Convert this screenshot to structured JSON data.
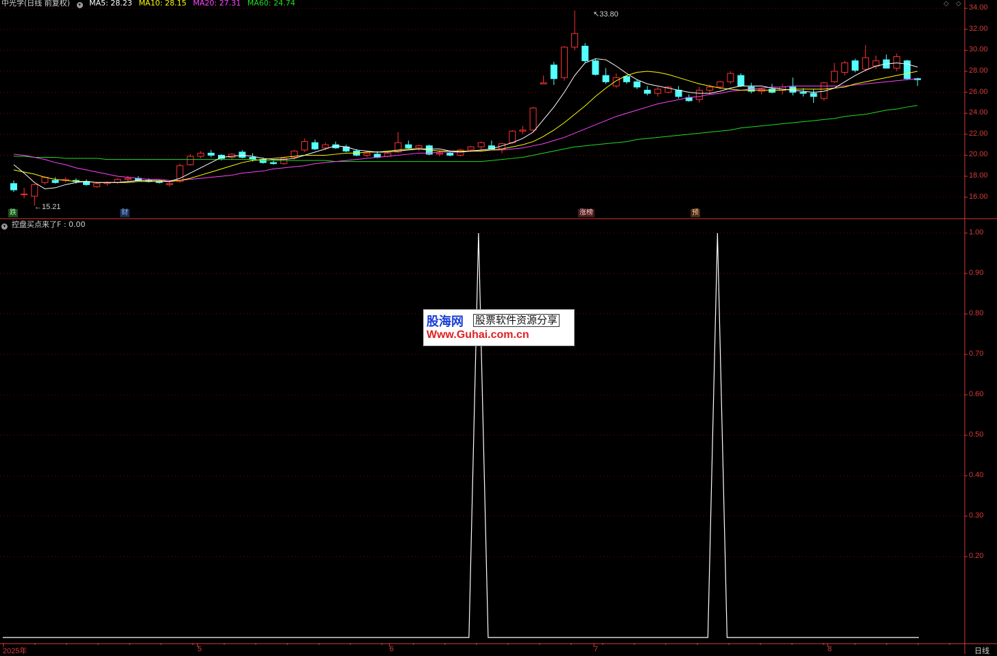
{
  "stock": {
    "title": "中光学(日线 前复权)"
  },
  "ma": {
    "ma5": "MA5: 28.23",
    "ma5_color": "#ffffff",
    "ma10": "MA10: 28.15",
    "ma10_color": "#ffff00",
    "ma20": "MA20: 27.31",
    "ma20_color": "#ff44ff",
    "ma60": "MA60: 24.74",
    "ma60_color": "#22dd22"
  },
  "indicator": {
    "label": "控盘买点来了F : 0.00"
  },
  "price_axis": [
    "34.00",
    "32.00",
    "30.00",
    "28.00",
    "26.00",
    "24.00",
    "22.00",
    "20.00",
    "18.00",
    "16.00"
  ],
  "ind_axis": [
    "1.00",
    "0.90",
    "0.80",
    "0.70",
    "0.60",
    "0.50",
    "0.40",
    "0.30",
    "0.20"
  ],
  "x_axis": [
    "2025年",
    "5",
    "6",
    "7",
    "8"
  ],
  "period": "日线",
  "high_label": "33.80",
  "low_label": "15.21",
  "markers": {
    "m1": "跌",
    "m2": "财",
    "m3": "涨榜",
    "m4": "预"
  },
  "watermark": {
    "logo": "股海网",
    "slogan": "股票软件资源分享",
    "url": "Www.Guhai.com.cn"
  },
  "colors": {
    "up": "#ff3232",
    "down": "#54ffff",
    "grid": "#8b0000",
    "axis": "#d63a3a"
  },
  "chart_data": {
    "type": "candlestick",
    "ohlc": [
      [
        17.3,
        17.6,
        16.5,
        16.7
      ],
      [
        16.3,
        16.9,
        15.9,
        16.3
      ],
      [
        16.1,
        17.3,
        15.21,
        17.2
      ],
      [
        17.4,
        18.0,
        17.2,
        17.9
      ],
      [
        17.6,
        17.9,
        17.3,
        17.4
      ],
      [
        17.6,
        17.9,
        17.4,
        17.7
      ],
      [
        17.6,
        17.8,
        17.3,
        17.5
      ],
      [
        17.5,
        17.7,
        17.1,
        17.2
      ],
      [
        17.0,
        17.4,
        16.9,
        17.3
      ],
      [
        17.3,
        17.5,
        17.1,
        17.4
      ],
      [
        17.4,
        17.8,
        17.3,
        17.7
      ],
      [
        17.7,
        18.0,
        17.5,
        17.8
      ],
      [
        17.8,
        18.0,
        17.6,
        17.6
      ],
      [
        17.6,
        17.8,
        17.4,
        17.5
      ],
      [
        17.5,
        17.6,
        17.3,
        17.4
      ],
      [
        17.2,
        17.5,
        17.0,
        17.3
      ],
      [
        17.5,
        19.2,
        17.4,
        19.0
      ],
      [
        19.1,
        20.1,
        19.0,
        19.9
      ],
      [
        19.9,
        20.4,
        19.7,
        20.2
      ],
      [
        20.2,
        20.5,
        19.8,
        20.0
      ],
      [
        20.0,
        20.1,
        19.5,
        19.7
      ],
      [
        19.8,
        20.2,
        19.6,
        20.1
      ],
      [
        20.3,
        20.5,
        19.7,
        19.8
      ],
      [
        19.8,
        20.2,
        19.4,
        19.6
      ],
      [
        19.6,
        19.8,
        19.2,
        19.3
      ],
      [
        19.3,
        19.5,
        19.1,
        19.2
      ],
      [
        19.2,
        19.8,
        19.1,
        19.7
      ],
      [
        19.8,
        20.5,
        19.6,
        20.4
      ],
      [
        20.5,
        21.6,
        20.3,
        21.3
      ],
      [
        21.2,
        21.5,
        20.5,
        20.6
      ],
      [
        20.7,
        21.2,
        20.5,
        21.0
      ],
      [
        21.0,
        21.3,
        20.6,
        20.7
      ],
      [
        20.8,
        21.0,
        20.3,
        20.4
      ],
      [
        20.4,
        20.6,
        19.9,
        20.0
      ],
      [
        20.0,
        20.3,
        19.8,
        20.2
      ],
      [
        20.1,
        20.4,
        19.7,
        19.8
      ],
      [
        19.9,
        20.3,
        19.8,
        20.2
      ],
      [
        20.3,
        22.2,
        20.2,
        21.2
      ],
      [
        21.0,
        21.4,
        20.6,
        20.7
      ],
      [
        20.7,
        21.0,
        20.4,
        20.9
      ],
      [
        20.9,
        21.0,
        20.0,
        20.1
      ],
      [
        20.1,
        20.5,
        19.9,
        20.2
      ],
      [
        20.2,
        20.4,
        19.9,
        20.0
      ],
      [
        20.0,
        20.6,
        19.9,
        20.5
      ],
      [
        20.5,
        20.9,
        20.3,
        20.8
      ],
      [
        20.8,
        21.3,
        20.5,
        21.2
      ],
      [
        20.9,
        21.4,
        20.6,
        20.6
      ],
      [
        20.6,
        21.2,
        20.2,
        21.1
      ],
      [
        21.2,
        22.4,
        21.1,
        22.3
      ],
      [
        22.3,
        22.8,
        22.0,
        22.4
      ],
      [
        22.4,
        24.6,
        22.2,
        24.5
      ],
      [
        26.8,
        27.6,
        26.8,
        26.9
      ],
      [
        28.6,
        28.9,
        26.7,
        27.3
      ],
      [
        27.4,
        30.4,
        27.1,
        30.3
      ],
      [
        30.3,
        33.8,
        30.0,
        31.6
      ],
      [
        30.4,
        30.7,
        28.8,
        29.0
      ],
      [
        29.0,
        29.2,
        27.6,
        27.7
      ],
      [
        27.6,
        28.3,
        26.8,
        27.0
      ],
      [
        26.6,
        27.8,
        26.4,
        27.4
      ],
      [
        27.5,
        27.6,
        26.8,
        27.0
      ],
      [
        27.0,
        27.2,
        26.3,
        26.5
      ],
      [
        26.2,
        26.6,
        25.7,
        25.9
      ],
      [
        25.9,
        26.5,
        25.6,
        26.3
      ],
      [
        26.0,
        26.6,
        25.9,
        26.5
      ],
      [
        26.2,
        26.6,
        25.4,
        25.6
      ],
      [
        25.5,
        25.8,
        25.1,
        25.2
      ],
      [
        25.3,
        26.5,
        25.0,
        26.2
      ],
      [
        26.2,
        26.7,
        25.8,
        26.5
      ],
      [
        26.5,
        27.1,
        26.3,
        27.0
      ],
      [
        27.0,
        28.0,
        26.8,
        27.8
      ],
      [
        27.6,
        27.8,
        26.5,
        26.6
      ],
      [
        26.5,
        26.9,
        25.9,
        26.1
      ],
      [
        26.1,
        26.4,
        25.8,
        26.3
      ],
      [
        26.3,
        26.8,
        25.9,
        26.0
      ],
      [
        26.2,
        26.8,
        25.8,
        26.5
      ],
      [
        26.5,
        27.4,
        25.7,
        26.0
      ],
      [
        26.0,
        26.4,
        25.6,
        25.9
      ],
      [
        25.9,
        26.3,
        25.0,
        25.6
      ],
      [
        25.4,
        27.0,
        25.2,
        26.9
      ],
      [
        27.0,
        28.8,
        26.9,
        28.0
      ],
      [
        27.9,
        29.0,
        27.6,
        28.8
      ],
      [
        29.0,
        29.2,
        27.9,
        28.1
      ],
      [
        28.2,
        30.5,
        28.0,
        29.3
      ],
      [
        28.5,
        29.5,
        28.2,
        29.0
      ],
      [
        29.1,
        29.6,
        28.3,
        28.3
      ],
      [
        28.3,
        29.7,
        28.0,
        29.4
      ],
      [
        29.0,
        29.1,
        27.2,
        27.3
      ],
      [
        27.3,
        27.4,
        26.6,
        27.2
      ]
    ],
    "ma5": [
      19.1,
      18.3,
      17.4,
      16.8,
      16.9,
      17.2,
      17.4,
      17.5,
      17.4,
      17.4,
      17.4,
      17.5,
      17.6,
      17.6,
      17.6,
      17.5,
      17.8,
      18.3,
      18.8,
      19.3,
      19.8,
      19.9,
      20.0,
      19.9,
      19.7,
      19.6,
      19.6,
      19.7,
      20.0,
      20.3,
      20.6,
      20.9,
      20.8,
      20.5,
      20.4,
      20.3,
      20.3,
      20.4,
      20.5,
      20.6,
      20.6,
      20.6,
      20.4,
      20.3,
      20.4,
      20.5,
      20.6,
      20.9,
      21.2,
      21.6,
      22.2,
      23.4,
      24.6,
      26.0,
      27.6,
      28.8,
      29.2,
      29.1,
      28.5,
      27.8,
      27.2,
      26.8,
      26.6,
      26.4,
      26.2,
      26.0,
      25.9,
      25.9,
      26.1,
      26.4,
      26.6,
      26.6,
      26.6,
      26.4,
      26.3,
      26.2,
      26.1,
      26.0,
      26.1,
      26.4,
      27.0,
      27.6,
      28.1,
      28.5,
      28.7,
      28.8,
      28.7,
      28.4
    ],
    "ma10": [
      18.6,
      18.4,
      18.2,
      17.9,
      17.7,
      17.6,
      17.5,
      17.5,
      17.4,
      17.4,
      17.4,
      17.4,
      17.5,
      17.5,
      17.5,
      17.5,
      17.6,
      17.8,
      18.1,
      18.4,
      18.7,
      19.0,
      19.3,
      19.5,
      19.6,
      19.7,
      19.8,
      19.9,
      20.0,
      20.0,
      20.0,
      20.1,
      20.2,
      20.2,
      20.3,
      20.3,
      20.4,
      20.5,
      20.6,
      20.6,
      20.5,
      20.4,
      20.4,
      20.4,
      20.4,
      20.4,
      20.5,
      20.6,
      20.8,
      21.0,
      21.3,
      21.8,
      22.4,
      23.1,
      23.9,
      24.7,
      25.6,
      26.4,
      27.1,
      27.6,
      27.9,
      28.0,
      27.9,
      27.7,
      27.4,
      27.1,
      26.8,
      26.6,
      26.4,
      26.3,
      26.2,
      26.2,
      26.2,
      26.2,
      26.2,
      26.3,
      26.3,
      26.3,
      26.3,
      26.4,
      26.5,
      26.8,
      27.0,
      27.2,
      27.4,
      27.6,
      27.8,
      28.0
    ],
    "ma20": [
      20.1,
      20.0,
      19.8,
      19.6,
      19.3,
      19.1,
      18.8,
      18.6,
      18.4,
      18.2,
      18.0,
      17.9,
      17.8,
      17.7,
      17.7,
      17.6,
      17.6,
      17.7,
      17.8,
      17.9,
      18.0,
      18.1,
      18.3,
      18.4,
      18.5,
      18.7,
      18.8,
      18.9,
      19.0,
      19.2,
      19.3,
      19.4,
      19.5,
      19.6,
      19.7,
      19.8,
      19.9,
      20.0,
      20.1,
      20.2,
      20.2,
      20.3,
      20.3,
      20.3,
      20.4,
      20.4,
      20.5,
      20.5,
      20.6,
      20.7,
      20.9,
      21.1,
      21.4,
      21.7,
      22.1,
      22.5,
      22.9,
      23.3,
      23.7,
      24.0,
      24.3,
      24.6,
      24.9,
      25.1,
      25.3,
      25.5,
      25.6,
      25.8,
      25.9,
      26.1,
      26.2,
      26.3,
      26.4,
      26.5,
      26.5,
      26.6,
      26.6,
      26.6,
      26.6,
      26.6,
      26.6,
      26.7,
      26.8,
      26.9,
      27.0,
      27.1,
      27.2,
      27.3
    ],
    "ma60": [
      19.9,
      19.9,
      19.8,
      19.8,
      19.8,
      19.7,
      19.7,
      19.7,
      19.7,
      19.6,
      19.6,
      19.6,
      19.6,
      19.6,
      19.6,
      19.6,
      19.6,
      19.6,
      19.6,
      19.6,
      19.6,
      19.6,
      19.6,
      19.6,
      19.5,
      19.5,
      19.5,
      19.5,
      19.5,
      19.5,
      19.5,
      19.4,
      19.4,
      19.4,
      19.4,
      19.4,
      19.4,
      19.4,
      19.4,
      19.4,
      19.4,
      19.4,
      19.4,
      19.4,
      19.4,
      19.4,
      19.5,
      19.6,
      19.7,
      19.8,
      20.0,
      20.2,
      20.4,
      20.6,
      20.8,
      20.9,
      21.0,
      21.1,
      21.2,
      21.3,
      21.5,
      21.6,
      21.7,
      21.8,
      21.9,
      22.0,
      22.1,
      22.2,
      22.3,
      22.4,
      22.6,
      22.7,
      22.8,
      22.9,
      23.0,
      23.1,
      23.2,
      23.3,
      23.4,
      23.5,
      23.7,
      23.8,
      23.9,
      24.1,
      24.3,
      24.4,
      24.6,
      24.74
    ],
    "indicator": [
      0,
      0,
      0,
      0,
      0,
      0,
      0,
      0,
      0,
      0,
      0,
      0,
      0,
      0,
      0,
      0,
      0,
      0,
      0,
      0,
      0,
      0,
      0,
      0,
      0,
      0,
      0,
      0,
      0,
      0,
      0,
      0,
      0,
      0,
      0,
      0,
      0,
      0,
      0,
      0,
      0,
      0,
      0,
      0,
      0,
      0,
      1,
      0,
      0,
      0,
      0,
      0,
      0,
      0,
      0,
      0,
      0,
      0,
      0,
      0,
      0,
      0,
      0,
      0,
      0,
      0,
      0,
      0,
      0,
      1,
      0,
      0,
      0,
      0,
      0,
      0,
      0,
      0,
      0,
      0,
      0,
      0,
      0,
      0,
      0,
      0,
      0,
      0
    ],
    "price_range": [
      15.0,
      34.6
    ],
    "indicator_range": [
      0.0,
      1.0
    ]
  }
}
